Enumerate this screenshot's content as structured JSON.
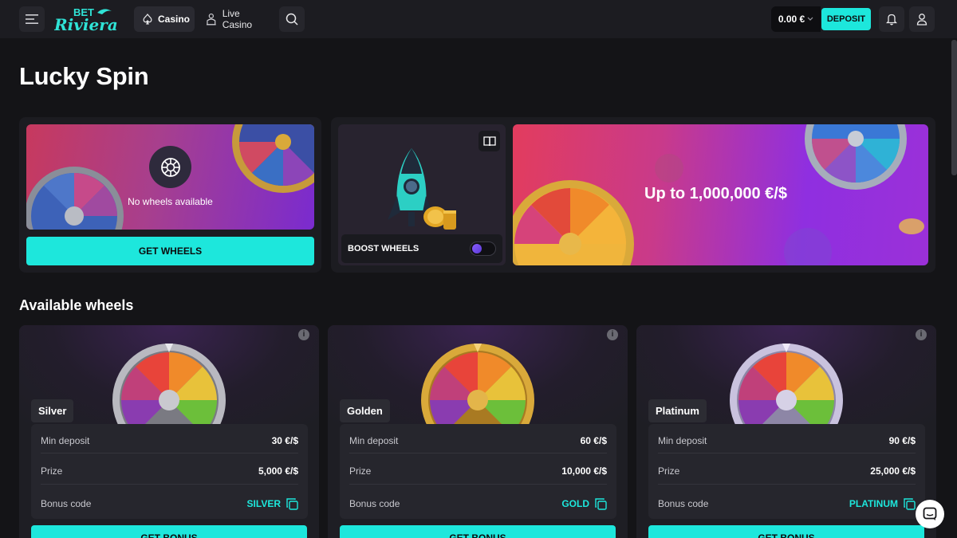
{
  "header": {
    "logo_text_top": "BET",
    "logo_text_bottom": "Riviera",
    "nav": [
      {
        "label": "Casino",
        "icon": "spade-icon",
        "active": true
      },
      {
        "label": "Live Casino",
        "icon": "dealer-icon",
        "active": false
      }
    ],
    "balance": "0.00 €",
    "deposit_label": "DEPOSIT"
  },
  "page": {
    "title": "Lucky Spin"
  },
  "wheels_panel": {
    "empty_text": "No wheels available",
    "get_wheels_label": "GET WHEELS"
  },
  "boost": {
    "label": "BOOST WHEELS",
    "enabled": false
  },
  "promo": {
    "text": "Up to 1,000,000 €/$"
  },
  "available": {
    "title": "Available wheels",
    "cards": [
      {
        "tier": "Silver",
        "min_deposit_label": "Min deposit",
        "min_deposit": "30 €/$",
        "prize_label": "Prize",
        "prize": "5,000 €/$",
        "bonus_code_label": "Bonus code",
        "bonus_code": "SILVER",
        "button": "GET BONUS",
        "rim": "#b9b9c0"
      },
      {
        "tier": "Golden",
        "min_deposit_label": "Min deposit",
        "min_deposit": "60 €/$",
        "prize_label": "Prize",
        "prize": "10,000 €/$",
        "bonus_code_label": "Bonus code",
        "bonus_code": "GOLD",
        "button": "GET BONUS",
        "rim": "#d9a93a"
      },
      {
        "tier": "Platinum",
        "min_deposit_label": "Min deposit",
        "min_deposit": "90 €/$",
        "prize_label": "Prize",
        "prize": "25,000 €/$",
        "bonus_code_label": "Bonus code",
        "bonus_code": "PLATINUM",
        "button": "GET BONUS",
        "rim": "#c9c2de"
      }
    ]
  },
  "colors": {
    "accent": "#1de7dc",
    "background": "#141417",
    "panel": "#1c1c21"
  }
}
